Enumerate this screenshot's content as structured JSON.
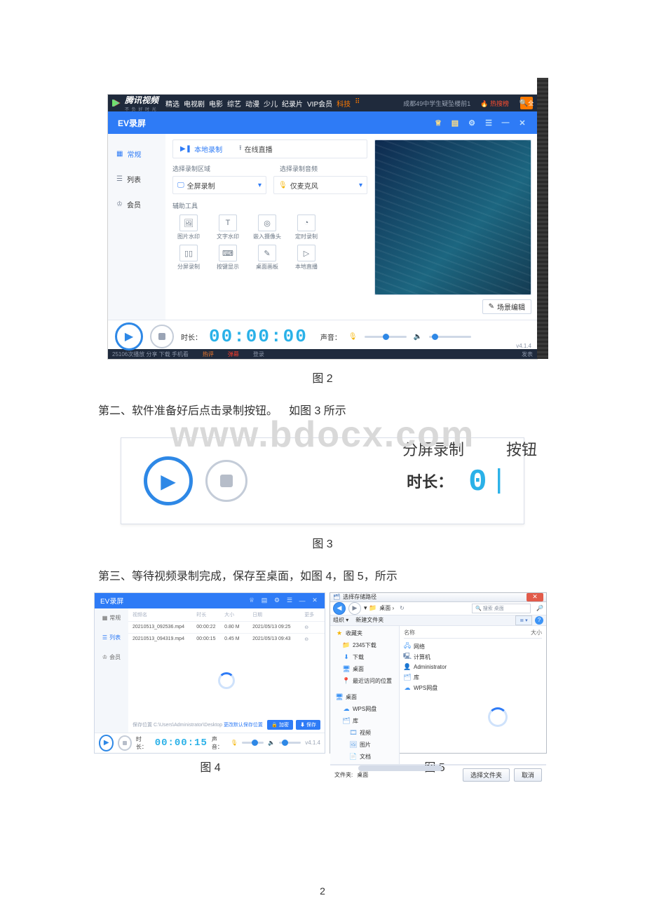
{
  "watermark": "www.bdocx.com",
  "captions": {
    "fig2": "图 2",
    "fig3": "图 3",
    "fig4": "图 4",
    "fig5": "图 5"
  },
  "body": {
    "step2": "第二、软件准备好后点击录制按钮。",
    "step2_ref": "如图 3 所示",
    "step3": "第三、等待视频录制完成，保存至桌面，如图  4，图  5，所示"
  },
  "page_number": "2",
  "tencent": {
    "brand": "腾讯视频",
    "slogan": "不 负 好 时 光",
    "nav": [
      "精选",
      "电视剧",
      "电影",
      "综艺",
      "动漫",
      "少儿",
      "纪录片",
      "VIP会员"
    ],
    "nav_hot": "科技",
    "all_icon": "⠿",
    "news": "成都49中学生疑坠楼前1",
    "hotlist": "热搜榜",
    "search": "全",
    "footer": [
      "25106次播放 分享 下载 手机看",
      "热评",
      "弹幕",
      "登录",
      "发表"
    ]
  },
  "ev": {
    "title": "EV录屏",
    "title_icons": [
      "crown-icon",
      "coupon-icon",
      "gear-icon",
      "menu-icon",
      "minimize-icon",
      "close-icon"
    ],
    "sidebar": [
      {
        "icon": "grid-icon",
        "label": "常规",
        "sel": true
      },
      {
        "icon": "list-icon",
        "label": "列表",
        "sel": false
      },
      {
        "icon": "member-icon",
        "label": "会员",
        "sel": false
      }
    ],
    "tabs": [
      {
        "icon": "record-local-icon",
        "label": "本地录制",
        "sel": true
      },
      {
        "icon": "live-icon",
        "label": "在线直播",
        "sel": false
      }
    ],
    "region_label": "选择录制区域",
    "audio_label": "选择录制音频",
    "region_select": {
      "icon": "screen-icon",
      "text": "全屏录制"
    },
    "audio_select": {
      "icon": "mic-icon",
      "text": "仅麦克风"
    },
    "tools_label": "辅助工具",
    "tools": [
      {
        "icon": "image-icon",
        "label": "图片水印"
      },
      {
        "icon": "text-icon",
        "label": "文字水印",
        "g": "T"
      },
      {
        "icon": "camera-icon",
        "label": "嵌入摄像头",
        "g": "◎"
      },
      {
        "icon": "timer-icon",
        "label": "定时录制",
        "g": "◔"
      },
      {
        "icon": "split-icon",
        "label": "分屏录制",
        "g": "▯▯"
      },
      {
        "icon": "keyboard-icon",
        "label": "按键显示",
        "g": "⌨"
      },
      {
        "icon": "board-icon",
        "label": "桌面画板",
        "g": "✎"
      },
      {
        "icon": "localplay-icon",
        "label": "本地直播",
        "g": "▷"
      }
    ],
    "scene_btn": "场景编辑",
    "playbar": {
      "time_label": "时长：",
      "time": "00:00:00",
      "sound_label": "声音："
    },
    "version": "v4.1.4"
  },
  "fig3": {
    "top_left": "分屏录制",
    "top_right": "按钮",
    "time_label": "时长：",
    "digits": "0"
  },
  "fig4": {
    "sidebar": [
      {
        "icon": "grid-icon",
        "label": "常规"
      },
      {
        "icon": "list-icon",
        "label": "列表",
        "sel": true
      },
      {
        "icon": "member-icon",
        "label": "会员"
      }
    ],
    "headers": [
      "视频名",
      "时长",
      "大小",
      "日期",
      "更多"
    ],
    "rows": [
      {
        "name": "20210513_092536.mp4",
        "dur": "00:00:22",
        "size": "0.80 M",
        "date": "2021/05/13 09:25",
        "op": "⊖"
      },
      {
        "name": "20210513_094319.mp4",
        "dur": "00:00:15",
        "size": "0.45 M",
        "date": "2021/05/13 09:43",
        "op": "⊖"
      }
    ],
    "save_path_label": "保存位置",
    "save_path": "C:\\Users\\Administrator\\Desktop",
    "save_path_action": "更改默认保存位置",
    "btn_encrypt": "加密",
    "btn_save": "保存",
    "rec_time": "00:00:15",
    "sound_label": "声音：",
    "version": "v4.1.4"
  },
  "fig5": {
    "title": "选择存储路径",
    "breadcrumb": "桌面 ›",
    "search_placeholder": "搜索 桌面",
    "toolbar_org": "组织 ▾",
    "toolbar_new": "新建文件夹",
    "view_label": "≣ ▾",
    "tree": {
      "fav": "收藏夹",
      "fav_items": [
        "2345下载",
        "下载",
        "桌面",
        "最近访问的位置"
      ],
      "desktop": "桌面",
      "desk_items": [
        "WPS网盘",
        "库",
        "视频",
        "图片",
        "文档"
      ]
    },
    "pane_header_name": "名称",
    "pane_header_size": "大小",
    "pane_items": [
      "网络",
      "计算机",
      "Administrator",
      "库",
      "WPS网盘"
    ],
    "filename_label": "文件夹:",
    "filename_value": "桌面",
    "btn_select": "选择文件夹",
    "btn_cancel": "取消"
  }
}
